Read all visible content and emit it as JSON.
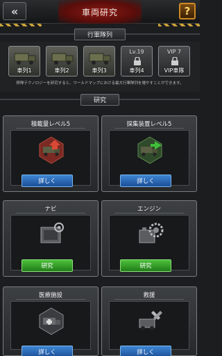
{
  "header": {
    "title": "車両研究",
    "back_icon": "double-chevron-left-icon",
    "help_label": "?"
  },
  "formation": {
    "section_title": "行軍隊列",
    "slots": [
      {
        "label": "車列1",
        "locked": false
      },
      {
        "label": "車列2",
        "locked": false
      },
      {
        "label": "車列3",
        "locked": false
      },
      {
        "label": "車列4",
        "level": "Lv.19",
        "locked": true
      },
      {
        "label": "VIP車隊",
        "level": "VIP 7",
        "locked": true
      }
    ],
    "description": "移隊テクノロジーを研究すると、ワールドマップにおける最大行軍隊列を増やすことができます。"
  },
  "research": {
    "section_title": "研究",
    "cards": [
      {
        "title": "積載量レベル5",
        "button": "詳しく",
        "button_color": "blue",
        "icon": "truck-capacity-icon"
      },
      {
        "title": "採集装置レベル5",
        "button": "詳しく",
        "button_color": "blue",
        "icon": "gathering-truck-icon"
      },
      {
        "title": "ナビ",
        "button": "研究",
        "button_color": "green",
        "icon": "navigation-icon"
      },
      {
        "title": "エンジン",
        "button": "研究",
        "button_color": "green",
        "icon": "engine-gear-icon"
      },
      {
        "title": "医療施設",
        "button": "詳しく",
        "button_color": "blue",
        "icon": "medical-truck-icon"
      },
      {
        "title": "救援",
        "button": "詳しく",
        "button_color": "blue",
        "icon": "rescue-wrench-icon"
      }
    ]
  }
}
